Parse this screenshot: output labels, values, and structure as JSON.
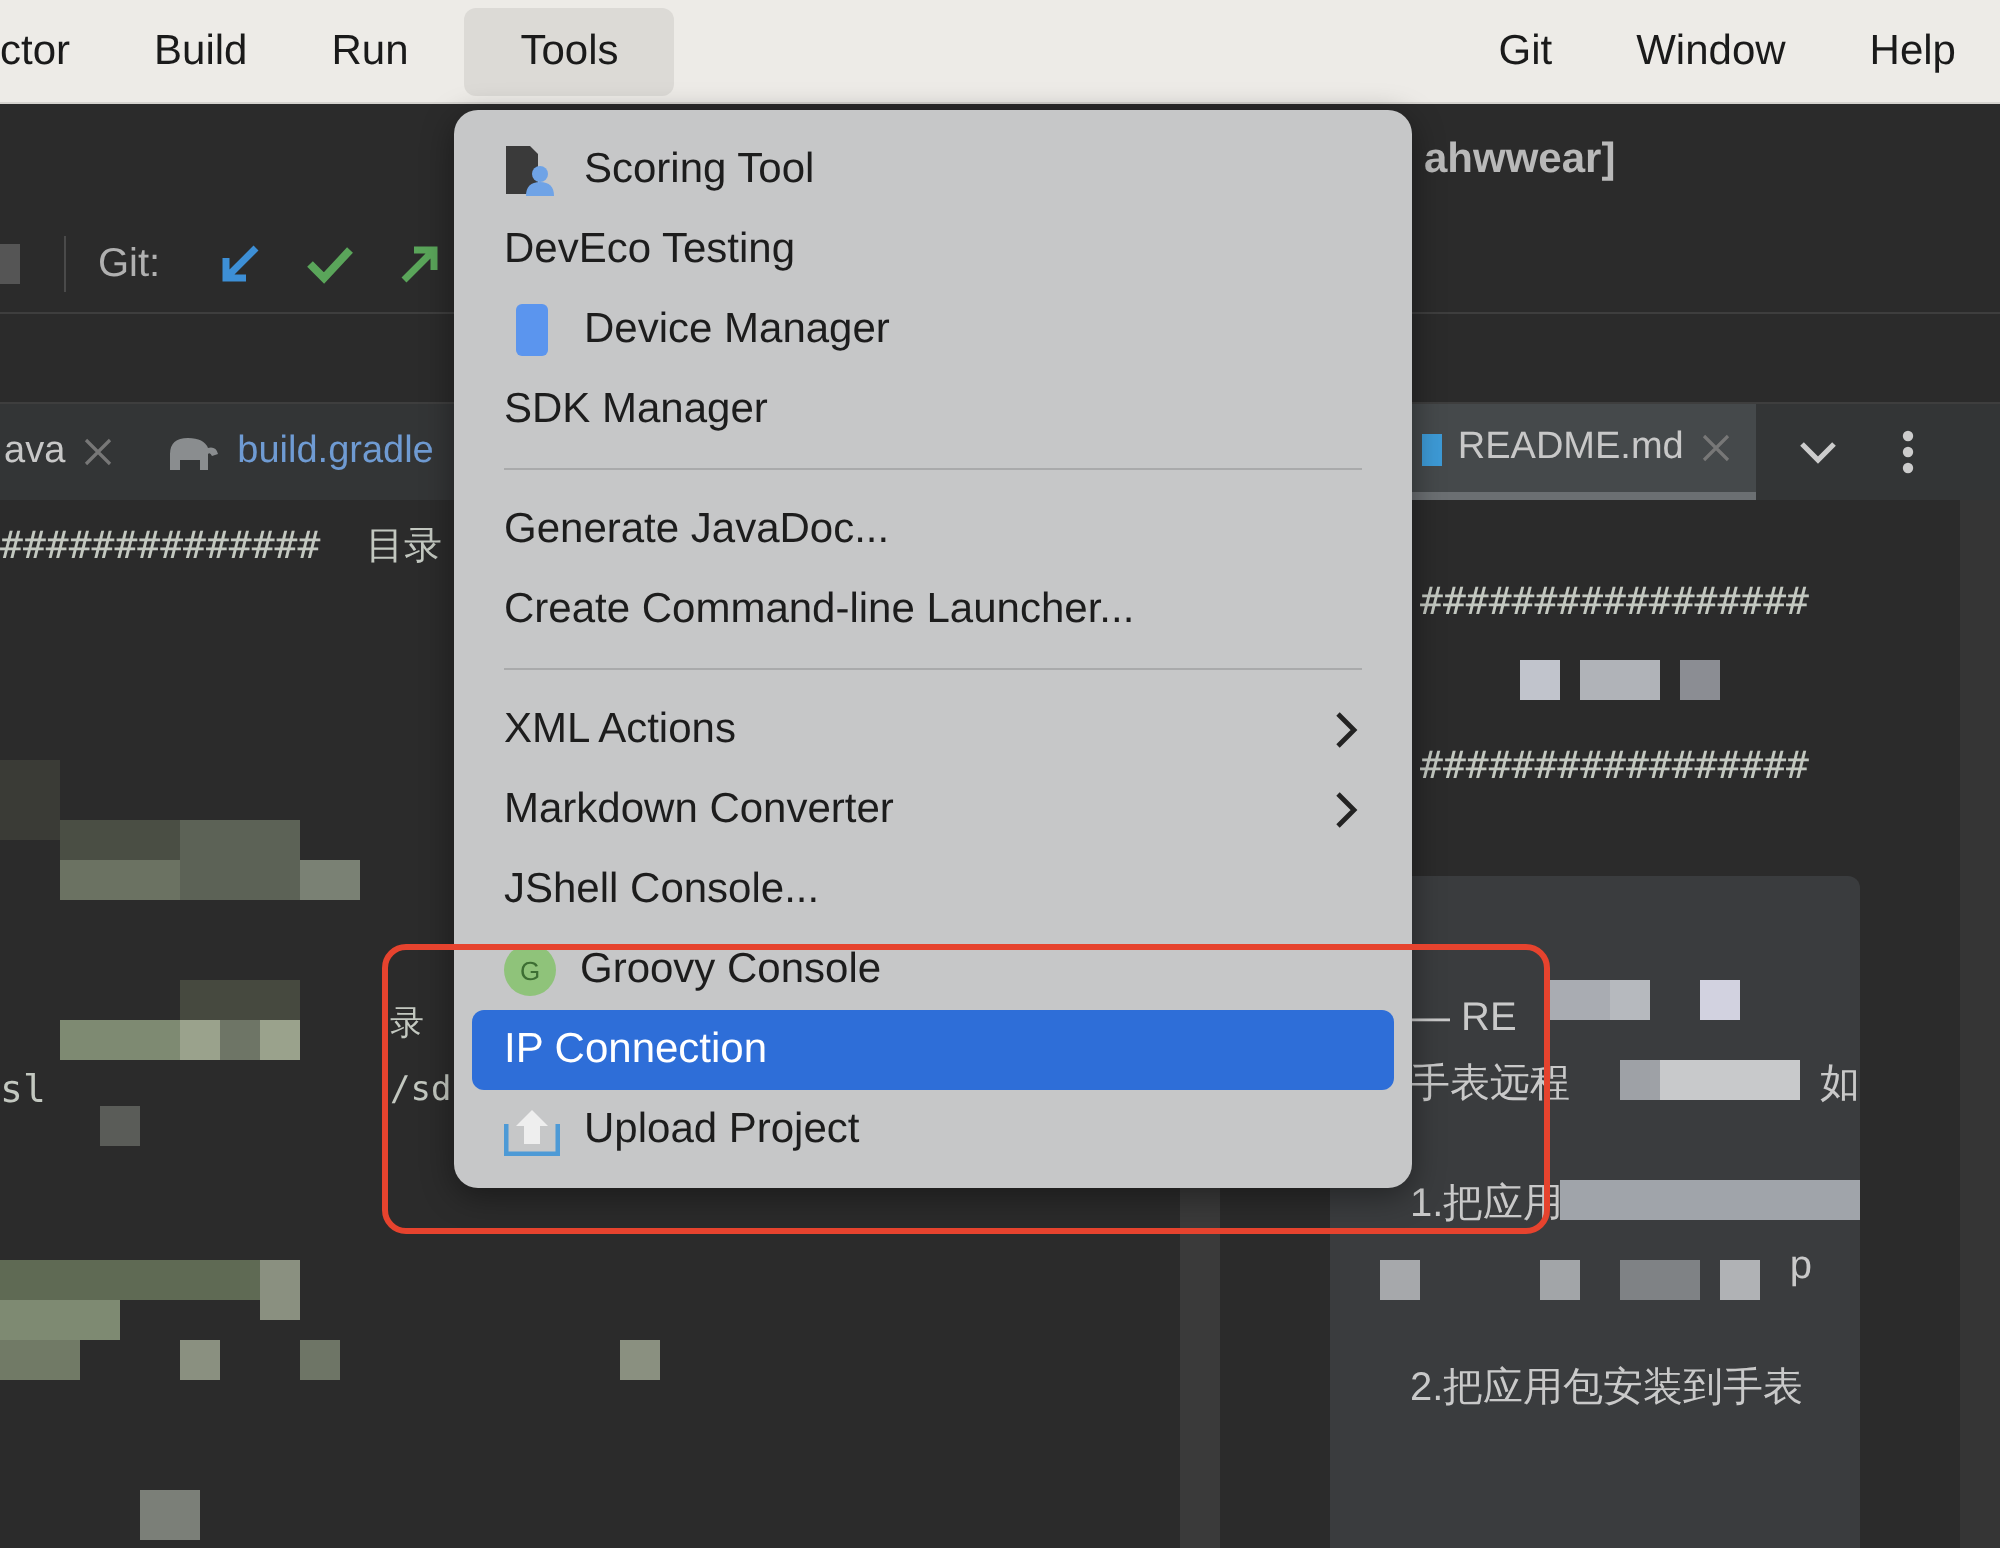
{
  "menu_bar": {
    "items": [
      {
        "label": "ctor",
        "selected": false
      },
      {
        "label": "Build",
        "selected": false
      },
      {
        "label": "Run",
        "selected": false
      },
      {
        "label": "Tools",
        "selected": true
      }
    ],
    "right_items": [
      {
        "label": "Git",
        "selected": false
      },
      {
        "label": "Window",
        "selected": false
      },
      {
        "label": "Help",
        "selected": false
      }
    ]
  },
  "toolbar": {
    "project_title": "ahwwear]",
    "git_label": "Git:"
  },
  "editor_tabs": [
    {
      "kind": "plain",
      "label": "ava",
      "closable": true,
      "selected": false
    },
    {
      "kind": "gradle",
      "label": "build.gradle",
      "closable": false,
      "selected": false
    },
    {
      "kind": "file",
      "label": "README.md",
      "closable": true,
      "selected": true
    }
  ],
  "left_editor": {
    "lines": [
      {
        "text": "##############  目录"
      },
      {
        "tail": "录"
      },
      {
        "text": "sl",
        "tail": "/sd"
      }
    ]
  },
  "right_editor": {
    "lines": [
      "#################",
      "#################"
    ]
  },
  "preview": {
    "lines": [
      {
        "text": "— RE"
      },
      {
        "text": "手表远程",
        "tail": "如"
      },
      {
        "text": "1.把应用"
      },
      {
        "tail": "p"
      },
      {
        "text": "2.把应用包安装到手表"
      }
    ]
  },
  "tools_menu": {
    "items": [
      {
        "kind": "scoring",
        "label": "Scoring Tool",
        "submenu": false,
        "selected": false
      },
      {
        "kind": "plain",
        "label": "DevEco Testing",
        "submenu": false,
        "selected": false
      },
      {
        "kind": "device",
        "label": "Device Manager",
        "submenu": false,
        "selected": false
      },
      {
        "kind": "plain",
        "label": "SDK Manager",
        "submenu": false,
        "selected": false
      },
      {
        "kind": "separator"
      },
      {
        "kind": "plain",
        "label": "Generate JavaDoc...",
        "submenu": false,
        "selected": false
      },
      {
        "kind": "plain",
        "label": "Create Command-line Launcher...",
        "submenu": false,
        "selected": false
      },
      {
        "kind": "separator"
      },
      {
        "kind": "plain",
        "label": "XML Actions",
        "submenu": true,
        "selected": false
      },
      {
        "kind": "plain",
        "label": "Markdown Converter",
        "submenu": true,
        "selected": false
      },
      {
        "kind": "plain",
        "label": "JShell Console...",
        "submenu": false,
        "selected": false
      },
      {
        "kind": "groovy",
        "label": "Groovy Console",
        "icon_text": "G",
        "submenu": false,
        "selected": false
      },
      {
        "kind": "plain",
        "label": "IP Connection",
        "submenu": false,
        "selected": true
      },
      {
        "kind": "upload",
        "label": "Upload Project",
        "submenu": false,
        "selected": false
      }
    ]
  }
}
